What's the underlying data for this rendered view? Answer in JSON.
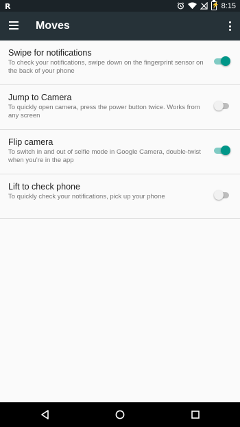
{
  "status_bar": {
    "carrier_logo": "R",
    "time": "8:15",
    "icons": [
      "alarm-icon",
      "wifi-icon",
      "no-signal-icon",
      "battery-charging-icon"
    ]
  },
  "app_bar": {
    "title": "Moves",
    "menu_icon": "hamburger-menu-icon",
    "overflow_icon": "more-vert-icon"
  },
  "settings": [
    {
      "title": "Swipe for notifications",
      "description": "To check your notifications, swipe down on the fingerprint sensor on the back of your phone",
      "enabled": true
    },
    {
      "title": "Jump to Camera",
      "description": "To quickly open camera, press the power button twice. Works from any screen",
      "enabled": false
    },
    {
      "title": "Flip camera",
      "description": "To switch in and out of selfie mode in Google Camera, double-twist when you’re in the app",
      "enabled": true
    },
    {
      "title": "Lift to check phone",
      "description": "To quickly check your notifications, pick up your phone",
      "enabled": false
    }
  ],
  "colors": {
    "app_bar": "#263238",
    "status_bar": "#1b2328",
    "accent": "#009688",
    "accent_track": "#80cbc4"
  },
  "nav_bar": {
    "buttons": [
      "back-icon",
      "home-icon",
      "recents-icon"
    ]
  }
}
